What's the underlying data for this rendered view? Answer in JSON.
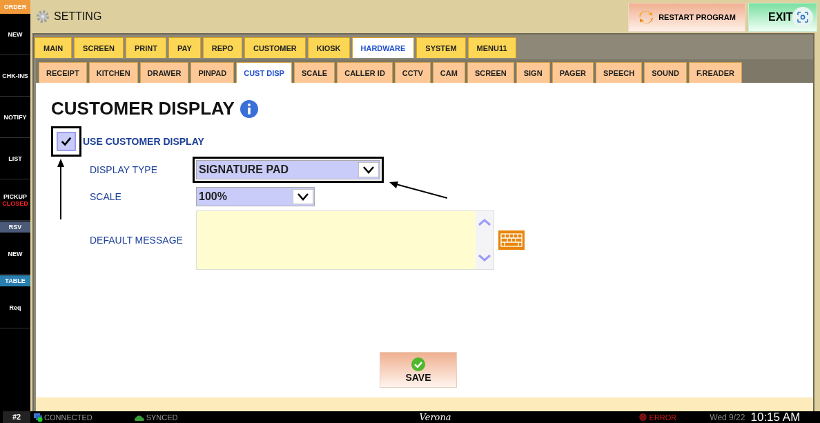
{
  "sidebar": {
    "header": "ORDER",
    "items": [
      {
        "kind": "button",
        "label": "NEW"
      },
      {
        "kind": "button",
        "label": "CHK-INS"
      },
      {
        "kind": "button",
        "label": "NOTIFY"
      },
      {
        "kind": "button",
        "label": "LIST"
      },
      {
        "kind": "button",
        "label": "PICKUP",
        "status": "CLOSED"
      },
      {
        "kind": "section",
        "label": "RSV",
        "color": "#4a5a78"
      },
      {
        "kind": "button",
        "label": "NEW"
      },
      {
        "kind": "section",
        "label": "TABLE",
        "color": "#2a7fb0"
      },
      {
        "kind": "button",
        "label": "Req"
      }
    ]
  },
  "header": {
    "title": "SETTING",
    "restart_button": "RESTART PROGRAM",
    "exit_button": "EXIT"
  },
  "tabs": [
    {
      "label": "MAIN",
      "selected": false
    },
    {
      "label": "SCREEN",
      "selected": false
    },
    {
      "label": "PRINT",
      "selected": false
    },
    {
      "label": "PAY",
      "selected": false
    },
    {
      "label": "REPO",
      "selected": false
    },
    {
      "label": "CUSTOMER",
      "selected": false
    },
    {
      "label": "KIOSK",
      "selected": false
    },
    {
      "label": "HARDWARE",
      "selected": true
    },
    {
      "label": "SYSTEM",
      "selected": false
    },
    {
      "label": "MENU11",
      "selected": false
    }
  ],
  "subtabs": [
    {
      "label": "RECEIPT",
      "selected": false
    },
    {
      "label": "KITCHEN",
      "selected": false
    },
    {
      "label": "DRAWER",
      "selected": false
    },
    {
      "label": "PINPAD",
      "selected": false
    },
    {
      "label": "CUST DISP",
      "selected": true
    },
    {
      "label": "SCALE",
      "selected": false
    },
    {
      "label": "CALLER ID",
      "selected": false
    },
    {
      "label": "CCTV",
      "selected": false
    },
    {
      "label": "CAM",
      "selected": false
    },
    {
      "label": "SCREEN",
      "selected": false
    },
    {
      "label": "SIGN",
      "selected": false
    },
    {
      "label": "PAGER",
      "selected": false
    },
    {
      "label": "SPEECH",
      "selected": false
    },
    {
      "label": "SOUND",
      "selected": false
    },
    {
      "label": "F.READER",
      "selected": false
    }
  ],
  "content": {
    "heading": "CUSTOMER DISPLAY",
    "use_display": {
      "label": "USE CUSTOMER DISPLAY",
      "checked": true
    },
    "display_type": {
      "label": "DISPLAY TYPE",
      "value": "SIGNATURE PAD"
    },
    "scale": {
      "label": "SCALE",
      "value": "100%"
    },
    "default_message": {
      "label": "DEFAULT MESSAGE"
    },
    "save_button": "SAVE"
  },
  "status_bar": {
    "terminal": "#2",
    "connection": "CONNECTED",
    "sync": "SYNCED",
    "store": "Verona",
    "error": "ERROR",
    "date": "Wed 9/22",
    "time": "10:15 AM"
  }
}
